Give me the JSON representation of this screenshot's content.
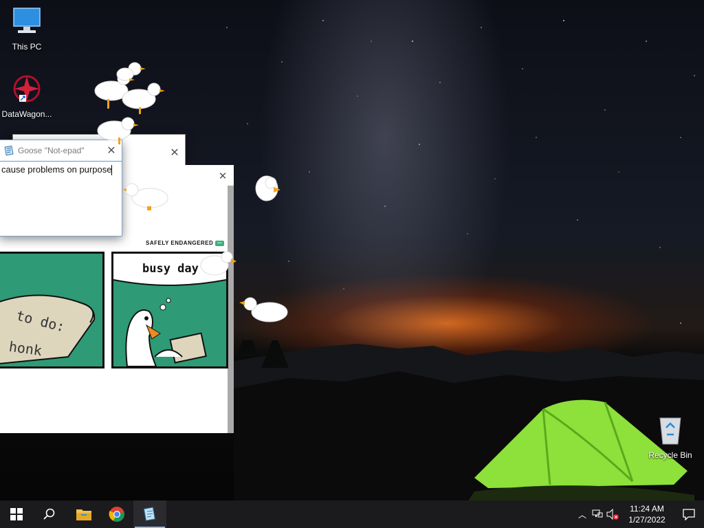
{
  "desktop": {
    "icons": [
      {
        "label": "This PC",
        "icon": "monitor-icon"
      },
      {
        "label": "DataWagon...",
        "icon": "datawagon-icon"
      },
      {
        "label": "Recycle Bin",
        "icon": "recycle-bin-icon"
      }
    ]
  },
  "notepad": {
    "title": "Goose \"Not-epad\"",
    "text": "cause problems on purpose",
    "close_icon": "close-icon"
  },
  "comic": {
    "brand": "SAFELY ENDANGERED",
    "panel_left_text_1": "to do:",
    "panel_left_text_2": "honk",
    "panel_right_caption": "busy day"
  },
  "taskbar": {
    "apps": [
      {
        "name": "start",
        "icon": "windows-logo-icon"
      },
      {
        "name": "search",
        "icon": "search-icon"
      },
      {
        "name": "file-explorer",
        "icon": "folder-icon"
      },
      {
        "name": "chrome",
        "icon": "chrome-icon"
      },
      {
        "name": "notepad",
        "icon": "notepad-icon"
      }
    ],
    "clock_time": "11:24 AM",
    "clock_date": "1/27/2022"
  },
  "colors": {
    "taskbar": "#1b1b1d",
    "comic_green": "#2e9a76",
    "tent_green": "#8ee03a"
  }
}
